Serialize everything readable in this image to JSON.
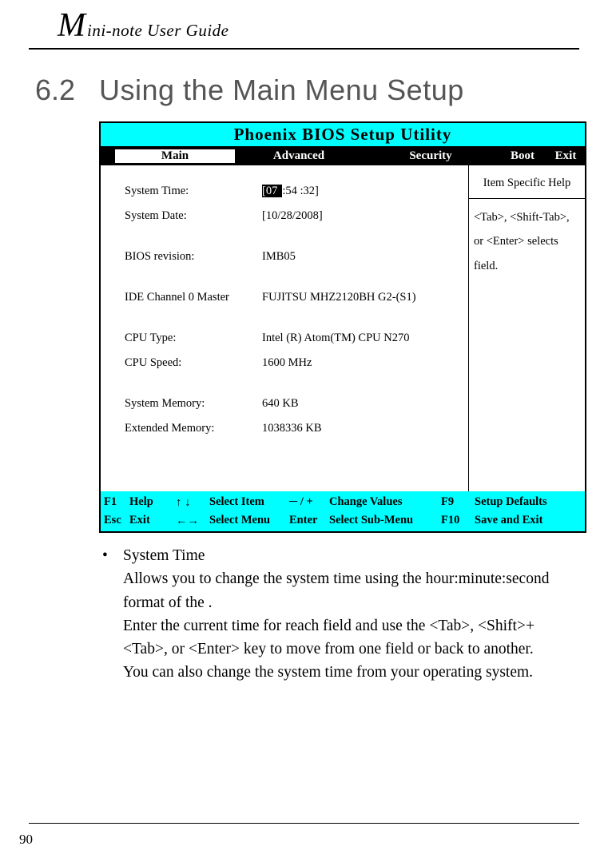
{
  "header": {
    "big": "M",
    "rest": "ini-note User Guide"
  },
  "section": {
    "num": "6.2",
    "title": "Using the Main Menu Setup"
  },
  "bios": {
    "title": "Phoenix BIOS Setup Utility",
    "tabs": {
      "main": "Main",
      "advanced": "Advanced",
      "security": "Security",
      "boot": "Boot",
      "exit": "Exit"
    },
    "rows": {
      "system_time_label": "System Time:",
      "system_time_hl": "[07",
      "system_time_rest": ":54 :32]",
      "system_date_label": "System Date:",
      "system_date_value": "[10/28/2008]",
      "bios_rev_label": "BIOS revision:",
      "bios_rev_value": "IMB05",
      "ide_label": "IDE Channel 0 Master",
      "ide_value": "FUJITSU MHZ2120BH G2-(S1)",
      "cpu_type_label": "CPU Type:",
      "cpu_type_value": "Intel (R) Atom(TM) CPU N270",
      "cpu_speed_label": "CPU Speed:",
      "cpu_speed_value": "1600 MHz",
      "sys_mem_label": "System Memory:",
      "sys_mem_value": "640 KB",
      "ext_mem_label": "Extended Memory:",
      "ext_mem_value": "1038336 KB"
    },
    "help": {
      "header": "Item Specific Help",
      "body": "<Tab>, <Shift-Tab>, or <Enter> selects field."
    },
    "footer": {
      "r1": {
        "k1": "F1",
        "k2": "Help",
        "k3": "↑ ↓",
        "k4": "Select Item",
        "k5": "─ / +",
        "k6": "Change Values",
        "k7": "F9",
        "k8": "Setup Defaults"
      },
      "r2": {
        "k1": "Esc",
        "k2": "Exit",
        "k3": "←→",
        "k4": "Select Menu",
        "k5": "Enter",
        "k6": "Select Sub-Menu",
        "k7": "F10",
        "k8": "Save and Exit"
      }
    }
  },
  "body_text": {
    "bullet_title": "System Time",
    "p1": "Allows you to change the system time using the hour:minute:second format of the .",
    "p2": "Enter the current time for reach field and use the <Tab>, <Shift>+<Tab>, or <Enter> key to move from one field or back to another.",
    "p3": "You can also change the system time from your operating system."
  },
  "page_number": "90"
}
